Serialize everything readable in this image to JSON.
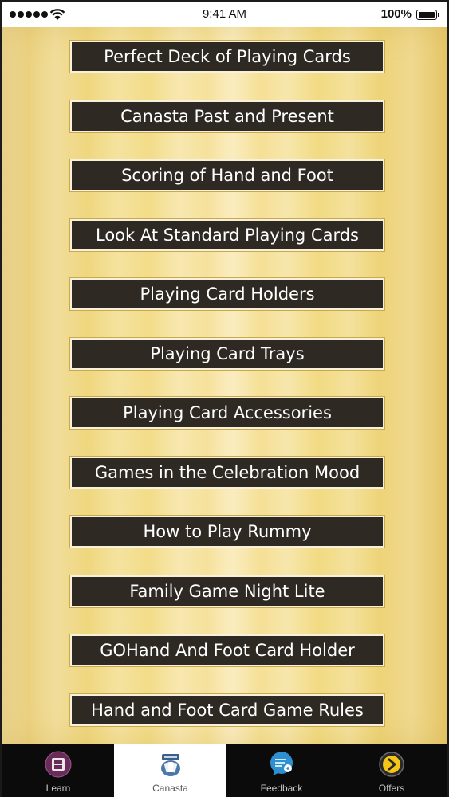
{
  "status_bar": {
    "time": "9:41 AM",
    "battery": "100%"
  },
  "menu": {
    "items": [
      {
        "label": "Perfect Deck of Playing Cards"
      },
      {
        "label": "Canasta Past and Present"
      },
      {
        "label": "Scoring of Hand and Foot"
      },
      {
        "label": "Look At Standard Playing Cards"
      },
      {
        "label": "Playing Card Holders"
      },
      {
        "label": "Playing Card Trays"
      },
      {
        "label": "Playing Card Accessories"
      },
      {
        "label": "Games in the Celebration Mood"
      },
      {
        "label": "How to Play Rummy"
      },
      {
        "label": "Family Game Night Lite"
      },
      {
        "label": "GOHand And Foot Card Holder"
      },
      {
        "label": "Hand and Foot Card Game Rules"
      }
    ]
  },
  "tab_bar": {
    "tabs": [
      {
        "label": "Learn",
        "icon": "film-icon",
        "active": false
      },
      {
        "label": "Canasta",
        "icon": "card-deck-icon",
        "active": true
      },
      {
        "label": "Feedback",
        "icon": "speech-bubble-icon",
        "active": false
      },
      {
        "label": "Offers",
        "icon": "chevron-circle-icon",
        "active": false
      }
    ]
  },
  "colors": {
    "button_bg": "#2f2923",
    "button_text": "#ffffff",
    "background_gold": "#f1d97e",
    "tab_bar_bg": "#0b0b0b",
    "tab_active_bg": "#ffffff"
  }
}
